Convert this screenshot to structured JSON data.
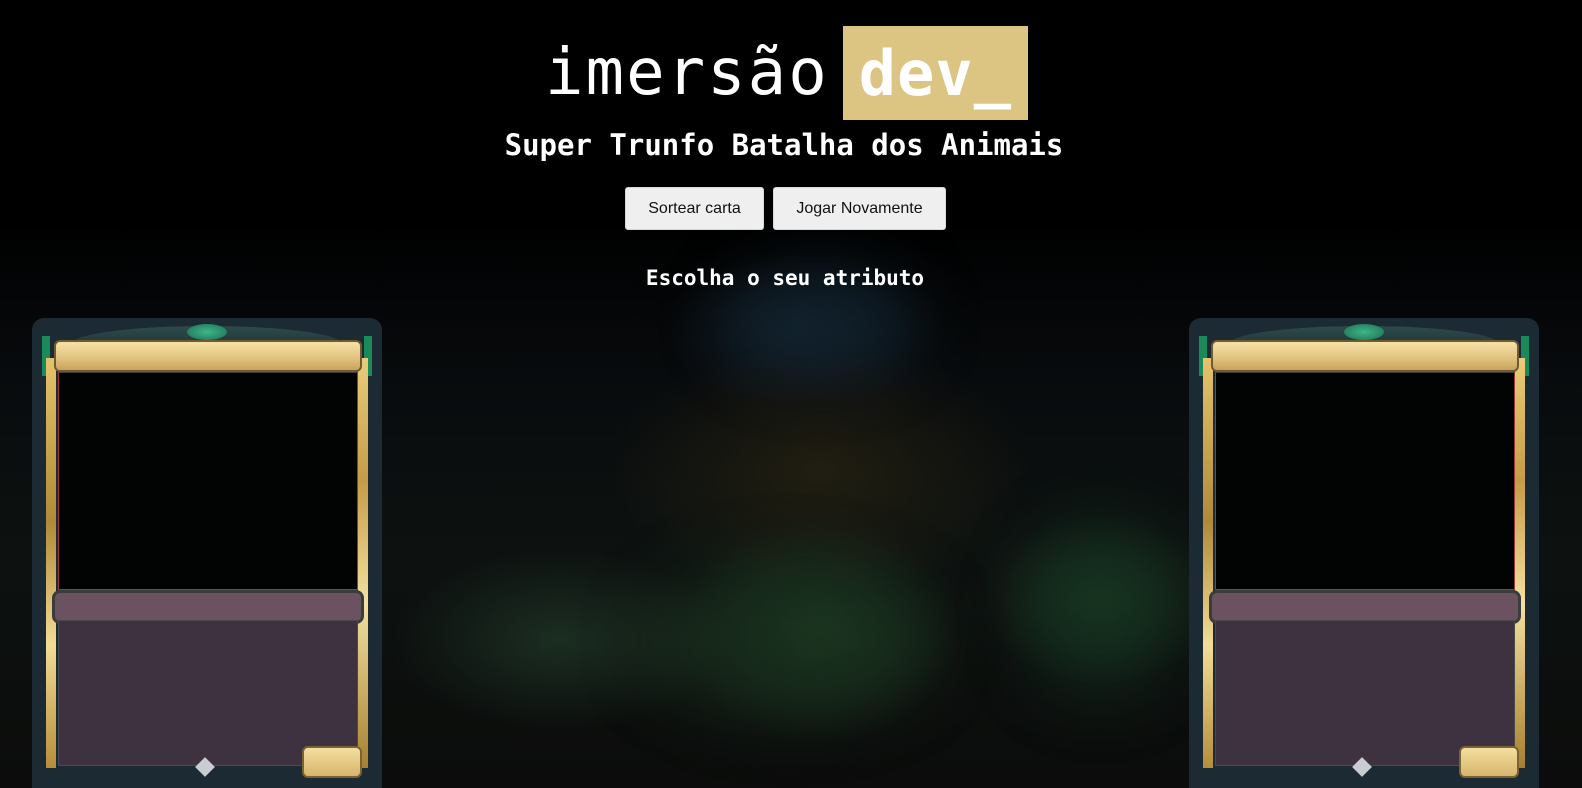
{
  "logo": {
    "word": "imersão",
    "highlight": "dev_",
    "highlight_color": "#dcc483"
  },
  "title": "Super Trunfo Batalha dos Animais",
  "buttons": {
    "draw_label": "Sortear carta",
    "replay_label": "Jogar Novamente"
  },
  "subtitle": "Escolha o seu atributo",
  "colors": {
    "background": "#000000",
    "card_border_gold": "#dcc483",
    "card_type_bar": "#6a5260",
    "card_text_area": "#3e3140"
  }
}
